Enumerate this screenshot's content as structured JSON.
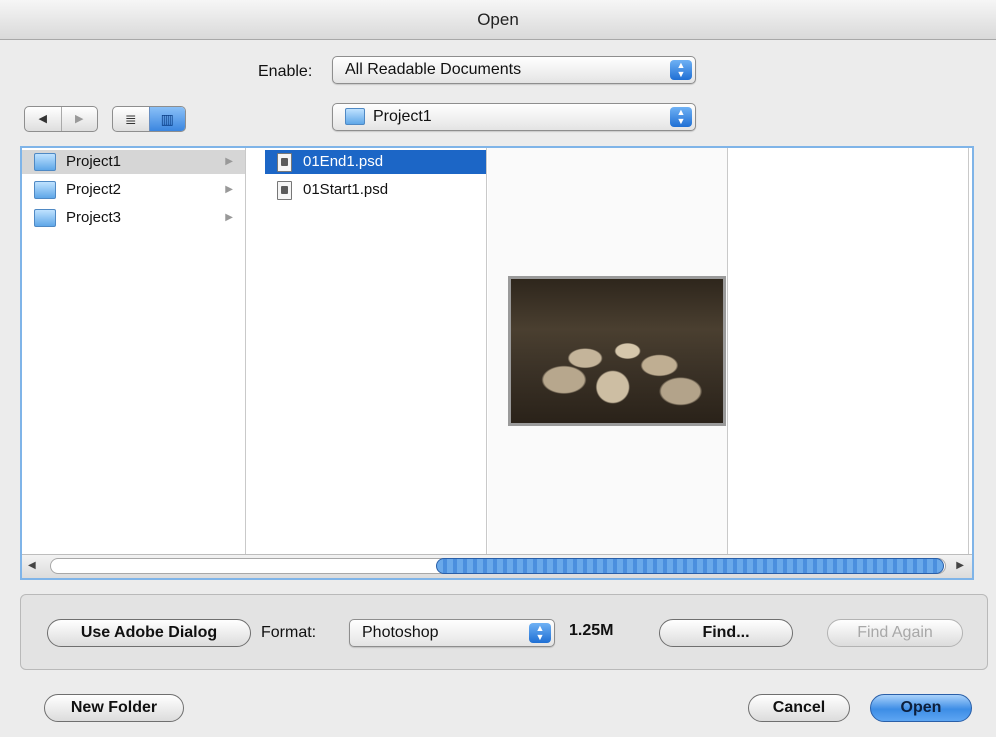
{
  "window": {
    "title": "Open"
  },
  "enable": {
    "label": "Enable:",
    "value": "All Readable Documents"
  },
  "location": {
    "value": "Project1"
  },
  "nav": {
    "back_glyph": "◀",
    "forward_glyph": "▶",
    "list_view_glyph": "≣",
    "column_view_glyph": "▥"
  },
  "columns": {
    "folders": [
      {
        "label": "Project1",
        "icon": "folder-icon",
        "selected": true
      },
      {
        "label": "Project2",
        "icon": "folder-icon",
        "selected": false
      },
      {
        "label": "Project3",
        "icon": "folder-icon",
        "selected": false
      }
    ],
    "files": [
      {
        "label": "01End1.psd",
        "icon": "psd-document-icon",
        "selected": true
      },
      {
        "label": "01Start1.psd",
        "icon": "psd-document-icon",
        "selected": false
      }
    ],
    "chevron_glyph": "▶"
  },
  "scroll": {
    "left_glyph": "◀",
    "right_glyph": "▶"
  },
  "options": {
    "use_adobe_dialog_label": "Use Adobe Dialog",
    "format_label": "Format:",
    "format_value": "Photoshop",
    "file_size": "1.25M",
    "find_label": "Find...",
    "find_again_label": "Find Again"
  },
  "footer": {
    "new_folder_label": "New Folder",
    "cancel_label": "Cancel",
    "open_label": "Open"
  },
  "colors": {
    "accent": "#1c66c6",
    "border_focus": "#7fb4e8"
  }
}
